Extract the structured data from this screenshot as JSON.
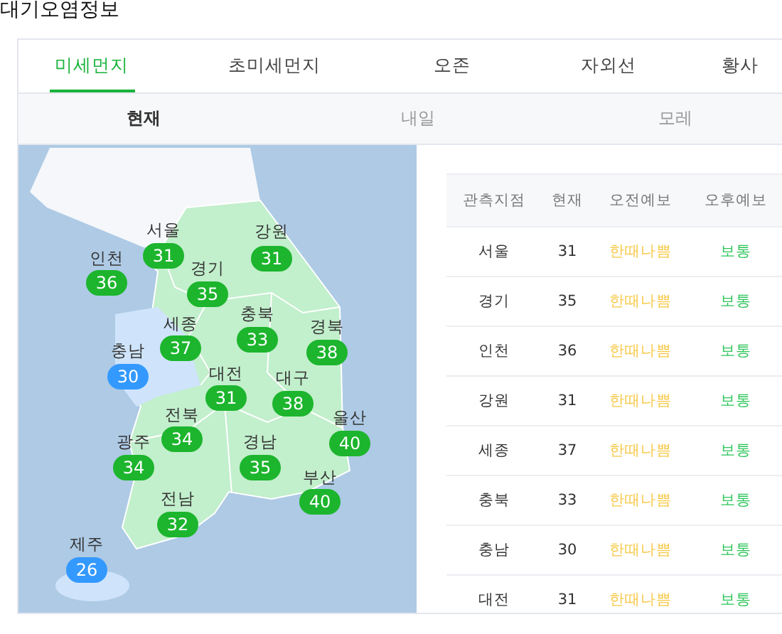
{
  "title": "대기오염정보",
  "tabs": [
    {
      "label": "미세먼지",
      "selected": true
    },
    {
      "label": "초미세먼지",
      "selected": false
    },
    {
      "label": "오존",
      "selected": false
    },
    {
      "label": "자외선",
      "selected": false
    },
    {
      "label": "황사",
      "selected": false
    }
  ],
  "day_tabs": [
    {
      "label": "현재",
      "selected": true
    },
    {
      "label": "내일",
      "selected": false
    },
    {
      "label": "모레",
      "selected": false
    }
  ],
  "map": {
    "regions": [
      {
        "name": "서울",
        "value": "31",
        "color": "#1cb52d"
      },
      {
        "name": "인천",
        "value": "36",
        "color": "#1cb52d"
      },
      {
        "name": "경기",
        "value": "35",
        "color": "#1cb52d"
      },
      {
        "name": "강원",
        "value": "31",
        "color": "#1cb52d"
      },
      {
        "name": "세종",
        "value": "37",
        "color": "#1cb52d"
      },
      {
        "name": "충남",
        "value": "30",
        "color": "#3399ff"
      },
      {
        "name": "충북",
        "value": "33",
        "color": "#1cb52d"
      },
      {
        "name": "경북",
        "value": "38",
        "color": "#1cb52d"
      },
      {
        "name": "대전",
        "value": "31",
        "color": "#1cb52d"
      },
      {
        "name": "대구",
        "value": "38",
        "color": "#1cb52d"
      },
      {
        "name": "울산",
        "value": "40",
        "color": "#1cb52d"
      },
      {
        "name": "전북",
        "value": "34",
        "color": "#1cb52d"
      },
      {
        "name": "광주",
        "value": "34",
        "color": "#1cb52d"
      },
      {
        "name": "경남",
        "value": "35",
        "color": "#1cb52d"
      },
      {
        "name": "부산",
        "value": "40",
        "color": "#1cb52d"
      },
      {
        "name": "전남",
        "value": "32",
        "color": "#1cb52d"
      },
      {
        "name": "제주",
        "value": "26",
        "color": "#3399ff"
      }
    ]
  },
  "table": {
    "columns": [
      "관측지점",
      "현재",
      "오전예보",
      "오후예보"
    ],
    "rows": [
      {
        "station": "서울",
        "now": "31",
        "am": {
          "text": "한때나쁨",
          "color": "#f7c948"
        },
        "pm": {
          "text": "보통",
          "color": "#2ec55a"
        }
      },
      {
        "station": "경기",
        "now": "35",
        "am": {
          "text": "한때나쁨",
          "color": "#f7c948"
        },
        "pm": {
          "text": "보통",
          "color": "#2ec55a"
        }
      },
      {
        "station": "인천",
        "now": "36",
        "am": {
          "text": "한때나쁨",
          "color": "#f7c948"
        },
        "pm": {
          "text": "보통",
          "color": "#2ec55a"
        }
      },
      {
        "station": "강원",
        "now": "31",
        "am": {
          "text": "한때나쁨",
          "color": "#f7c948"
        },
        "pm": {
          "text": "보통",
          "color": "#2ec55a"
        }
      },
      {
        "station": "세종",
        "now": "37",
        "am": {
          "text": "한때나쁨",
          "color": "#f7c948"
        },
        "pm": {
          "text": "보통",
          "color": "#2ec55a"
        }
      },
      {
        "station": "충북",
        "now": "33",
        "am": {
          "text": "한때나쁨",
          "color": "#f7c948"
        },
        "pm": {
          "text": "보통",
          "color": "#2ec55a"
        }
      },
      {
        "station": "충남",
        "now": "30",
        "am": {
          "text": "한때나쁨",
          "color": "#f7c948"
        },
        "pm": {
          "text": "보통",
          "color": "#2ec55a"
        }
      },
      {
        "station": "대전",
        "now": "31",
        "am": {
          "text": "한때나쁨",
          "color": "#f7c948"
        },
        "pm": {
          "text": "보통",
          "color": "#2ec55a"
        }
      }
    ]
  }
}
